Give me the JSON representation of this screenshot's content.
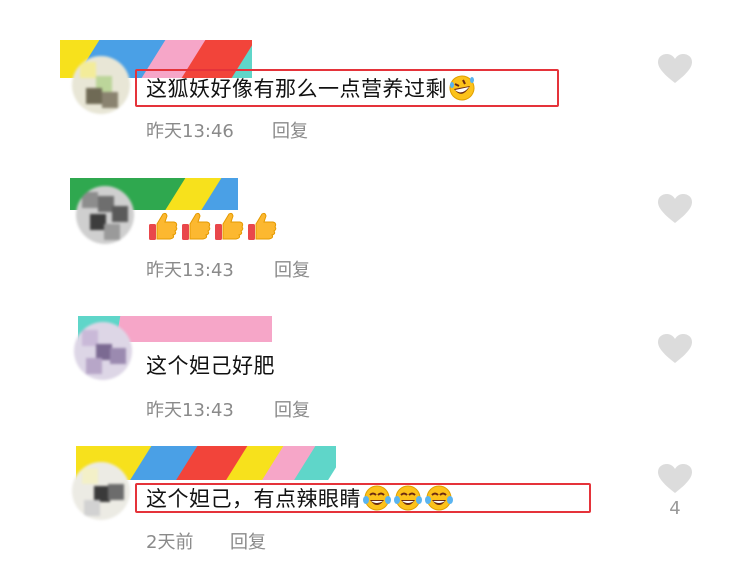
{
  "comments": [
    {
      "text": "这狐妖好像有那么一点营养过剩",
      "emojis": [
        "rofl-emoji"
      ],
      "time": "昨天13:46",
      "reply_label": "回复",
      "highlighted": true,
      "likes": ""
    },
    {
      "text": "",
      "emojis": [
        "thumbs-up-emoji",
        "thumbs-up-emoji",
        "thumbs-up-emoji",
        "thumbs-up-emoji"
      ],
      "time": "昨天13:43",
      "reply_label": "回复",
      "highlighted": false,
      "likes": ""
    },
    {
      "text": "这个妲己好肥",
      "emojis": [],
      "time": "昨天13:43",
      "reply_label": "回复",
      "highlighted": false,
      "likes": ""
    },
    {
      "text": "这个妲己，有点辣眼睛",
      "emojis": [
        "crying-laughing-emoji",
        "crying-laughing-emoji",
        "crying-laughing-emoji"
      ],
      "time": "2天前",
      "reply_label": "回复",
      "highlighted": true,
      "likes": "4"
    }
  ],
  "colors": {
    "highlight_border": "#e5333a",
    "meta_text": "#8a8a8a",
    "heart": "#dcdcdc",
    "censor_yellow": "#f7e11c",
    "censor_blue": "#4aa0e6",
    "censor_pink": "#f6a6c8",
    "censor_red": "#f2443a",
    "censor_teal": "#5fd6c9",
    "censor_green": "#2fa84f"
  }
}
